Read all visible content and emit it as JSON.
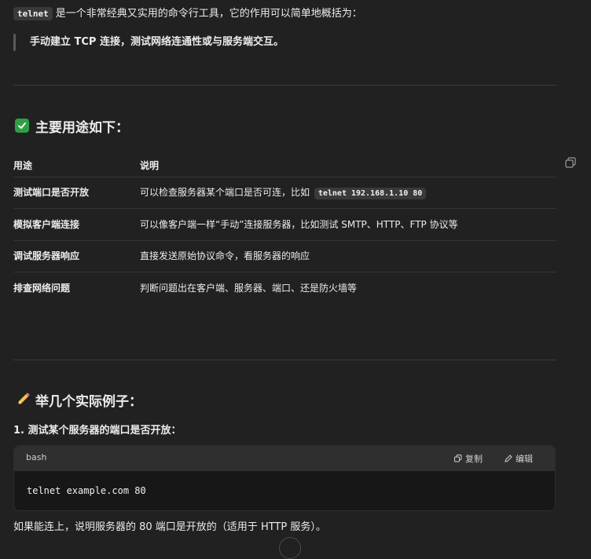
{
  "intro": {
    "code": "telnet",
    "text": "是一个非常经典又实用的命令行工具，它的作用可以简单地概括为："
  },
  "quote": "手动建立 TCP 连接，测试网络连通性或与服务端交互。",
  "section1": {
    "title": "主要用途如下：",
    "icon": "check-mark-button-icon"
  },
  "table": {
    "headers": [
      "用途",
      "说明"
    ],
    "rows": [
      {
        "use": "测试端口是否开放",
        "desc": "可以检查服务器某个端口是否可连，比如",
        "code": "telnet 192.168.1.10 80"
      },
      {
        "use": "模拟客户端连接",
        "desc": "可以像客户端一样“手动”连接服务器，比如测试 SMTP、HTTP、FTP 协议等"
      },
      {
        "use": "调试服务器响应",
        "desc": "直接发送原始协议命令，看服务器的响应"
      },
      {
        "use": "排查网络问题",
        "desc": "判断问题出在客户端、服务器、端口、还是防火墙等"
      }
    ]
  },
  "section2": {
    "title": "举几个实际例子：",
    "icon": "pencil-icon"
  },
  "example1": {
    "title": "1. 测试某个服务器的端口是否开放：",
    "lang": "bash",
    "copy_label": "复制",
    "edit_label": "编辑",
    "code": "telnet example.com 80"
  },
  "result": "如果能连上，说明服务器的 80 端口是开放的（适用于 HTTP 服务）。",
  "colors": {
    "background": "#212121",
    "check": "#2ea043",
    "code_bg": "#171717",
    "code_header": "#2f2f2f"
  }
}
